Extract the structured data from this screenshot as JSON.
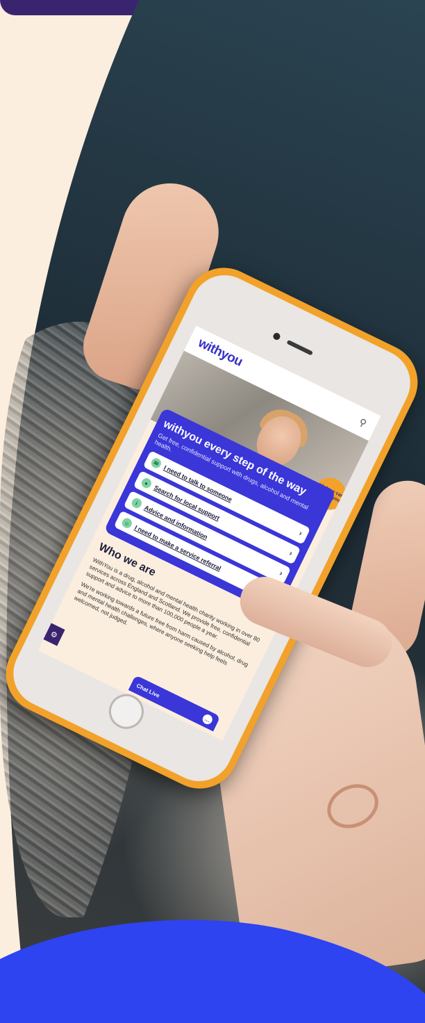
{
  "site": {
    "logo": "withyou",
    "hero_title": "withyou every step of the way",
    "hero_subtitle": "Get free, confidential support with drugs, alcohol and mental health.",
    "help_bubble": "Hi, how can we help you?",
    "options": [
      {
        "label": "I need to talk to someone",
        "icon": "chat-icon"
      },
      {
        "label": "Search for local support",
        "icon": "map-pin-icon"
      },
      {
        "label": "Advice and information",
        "icon": "info-icon"
      },
      {
        "label": "I need to make a service referral",
        "icon": "person-icon"
      }
    ],
    "who_heading": "Who we are",
    "who_para1": "WithYou is a drug, alcohol and mental health charity working in over 80 services across England and Scotland. We provide free, confidential support and advice to more than 100,000 people a year.",
    "who_para2": "We're working towards a future free from harm caused by alcohol, drug and mental health challenges, where anyone seeking help feels welcomed, not judged.",
    "chat_live": "Chat Live",
    "settings_icon": "gear-icon",
    "chevron": "›"
  },
  "colors": {
    "brand_blue": "#3a36d8",
    "brand_purple": "#3a2470",
    "accent_orange": "#f2a22a",
    "cream": "#fbeede"
  }
}
